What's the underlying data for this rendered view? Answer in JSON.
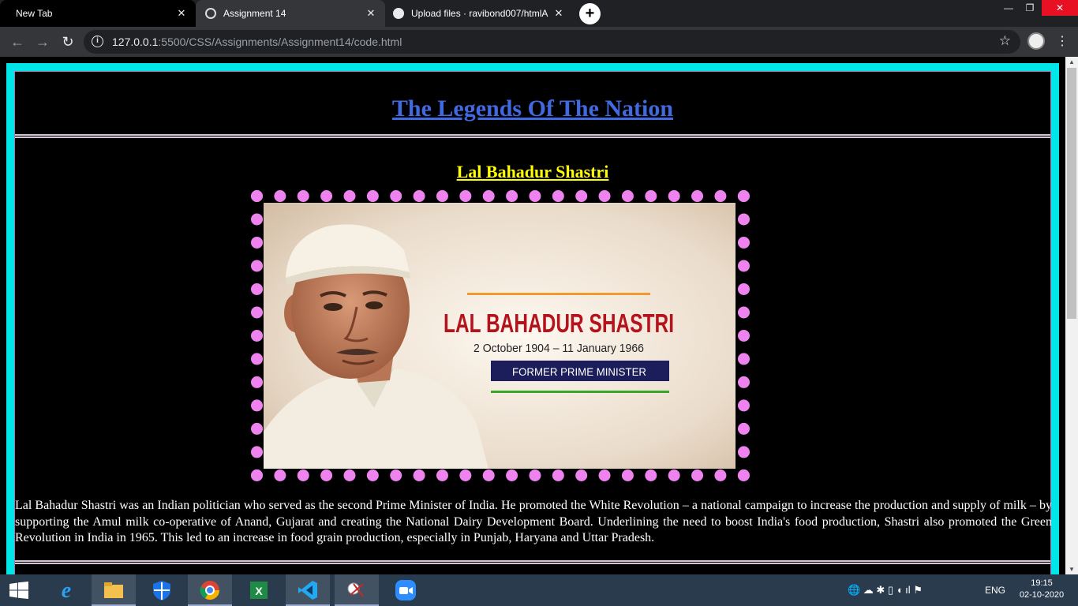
{
  "browser": {
    "tabs": [
      {
        "label": "New Tab",
        "active": false
      },
      {
        "label": "Assignment 14",
        "active": true
      },
      {
        "label": "Upload files · ravibond007/htmlA",
        "active": false
      }
    ],
    "new_tab_glyph": "+",
    "close_glyph": "✕",
    "window_controls": {
      "minimize": "—",
      "maximize": "❐",
      "close": "✕"
    },
    "url_host": "127.0.0.1",
    "url_rest": ":5500/CSS/Assignments/Assignment14/code.html",
    "star_glyph": "☆",
    "menu_glyph": "⋮",
    "nav": {
      "back": "←",
      "forward": "→",
      "reload": "↻"
    }
  },
  "page": {
    "title": "The Legends Of The Nation",
    "section_title": "Lal Bahadur Shastri",
    "portrait": {
      "name_text": "LAL BAHADUR SHASTRI",
      "dates_text": "2 October 1904 – 11 January 1966",
      "role_text": "FORMER PRIME MINISTER"
    },
    "bio": "Lal Bahadur Shastri was an Indian politician who served as the second Prime Minister of India. He promoted the White Revolution – a national campaign to increase the production and supply of milk – by supporting the Amul milk co-operative of Anand, Gujarat and creating the National Dairy Development Board. Underlining the need to boost India's food production, Shastri also promoted the Green Revolution in India in 1965. This led to an increase in food grain production, especially in Punjab, Haryana and Uttar Pradesh."
  },
  "taskbar": {
    "apps": [
      "start-icon",
      "internet-explorer-icon",
      "file-explorer-icon",
      "windows-defender-icon",
      "chrome-icon",
      "excel-icon",
      "vscode-icon",
      "snipping-tool-icon",
      "zoom-icon"
    ],
    "language": "ENG",
    "time": "19:15",
    "date": "02-10-2020"
  },
  "colors": {
    "frame": "#00e5e8",
    "title": "#4169e1",
    "section_title": "#ffff00",
    "dots": "#ee82ee"
  }
}
